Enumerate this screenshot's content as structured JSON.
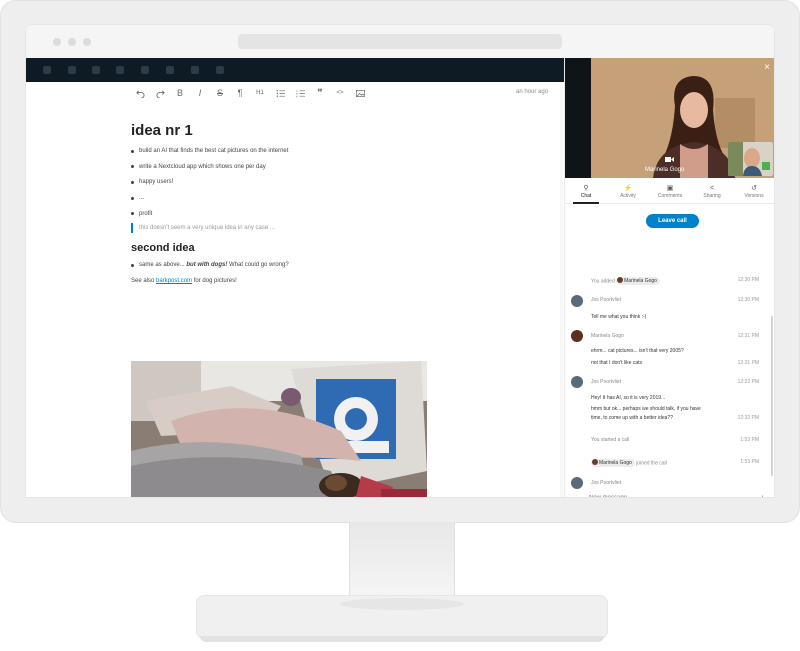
{
  "editor": {
    "toolbar": {
      "undo_icon": "undo-icon",
      "redo_icon": "redo-icon",
      "bold": "B",
      "italic": "I",
      "strike": "S",
      "paragraph": "¶",
      "heading": "H1",
      "bullet_list_icon": "bullet-list-icon",
      "ordered_list_icon": "ordered-list-icon",
      "quote": "❞",
      "code": "<>",
      "image_icon": "image-icon"
    },
    "timestamp": "an hour ago",
    "heading1": "idea nr 1",
    "bullets1": [
      "build an AI that finds the best cat pictures on the internet",
      "write a Nextcloud app which shows one per day",
      "happy users!",
      "...",
      "profit"
    ],
    "quote": "this doesn't seem a very unique idea in any case ...",
    "heading2": "second idea",
    "bullet2_plain": "same as above... ",
    "bullet2_emph": "but with dogs!",
    "bullet2_tail": " What could go wrong?",
    "para_prefix": "See also ",
    "para_link": "barkpost.com",
    "para_suffix": " for dog pictures!"
  },
  "sidebar": {
    "close": "×",
    "video_name": "Marinela Gogo",
    "tabs": [
      {
        "label": "Chat",
        "icon": "search-icon"
      },
      {
        "label": "Activity",
        "icon": "activity-icon"
      },
      {
        "label": "Comments",
        "icon": "comments-icon"
      },
      {
        "label": "Sharing",
        "icon": "share-icon"
      },
      {
        "label": "Versions",
        "icon": "history-icon"
      }
    ],
    "leave_call": "Leave call",
    "chat": {
      "system1_prefix": "You added",
      "system1_user": "Marinela Gogo",
      "system1_time": "12:30 PM",
      "m1_author": "Jos Poortvliet",
      "m1_time": "12:30 PM",
      "m1_text": "Tell me what you think :-)",
      "m2_author": "Marinela Gogo",
      "m2_time": "12:31 PM",
      "m2_text1": "ehrm... cat pictures... isn't that very 2005?",
      "m2_time2": "12:31 PM",
      "m2_text2": "not that I don't like cats",
      "m3_author": "Jos Poortvliet",
      "m3_time": "12:32 PM",
      "m3_text1": "Hey! It has AI, so it is very 2019...",
      "m3_text2a": "hmm but ok... perhaps we should talk, if you have",
      "m3_text2b": "time, to come up with a better idea??",
      "m3_time2": "12:32 PM",
      "system2": "You started a call",
      "system2_time": "1:53 PM",
      "system3_user": "Marinela Gogo",
      "system3_suffix": "joined the call",
      "system3_time": "1:53 PM",
      "m4_author": "Jos Poortvliet"
    },
    "compose_placeholder": "New message...",
    "send": "→",
    "add": "+"
  },
  "colors": {
    "accent": "#0082c9",
    "header": "#0e1a24"
  }
}
